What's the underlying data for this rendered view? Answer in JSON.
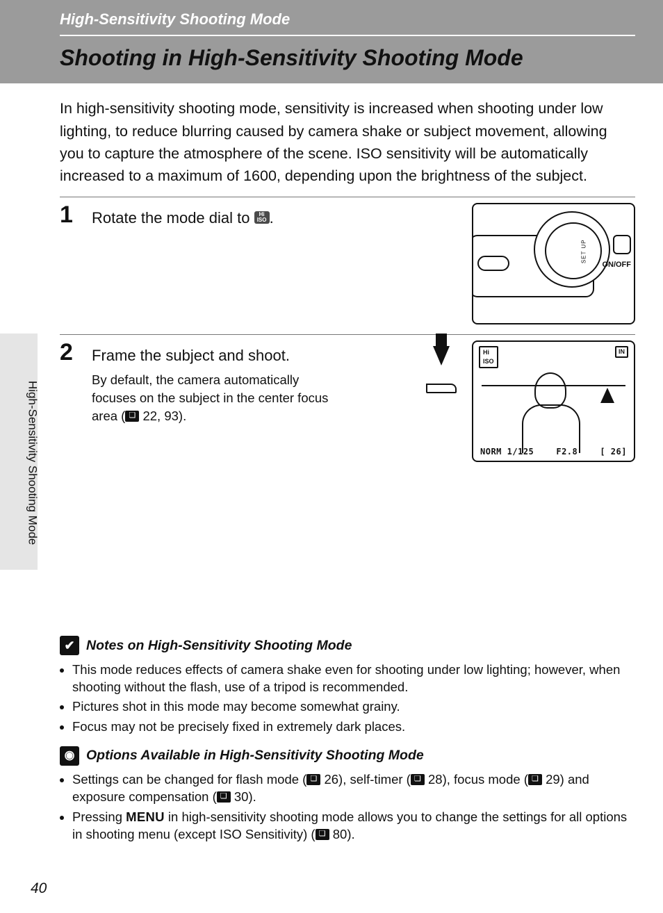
{
  "section_title": "High-Sensitivity Shooting Mode",
  "page_title": "Shooting in High-Sensitivity Shooting Mode",
  "intro": "In high-sensitivity shooting mode, sensitivity is increased when shooting under low lighting, to reduce blurring caused by camera shake or subject movement, allowing you to capture the atmosphere of the scene. ISO sensitivity will be automatically increased to a maximum of 1600, depending upon the brightness of the subject.",
  "steps": [
    {
      "num": "1",
      "title_pre": "Rotate the mode dial to ",
      "title_post": ".",
      "desc": ""
    },
    {
      "num": "2",
      "title_pre": "Frame the subject and shoot.",
      "title_post": "",
      "desc_pre": "By default, the camera automatically focuses on the subject in the center focus area (",
      "desc_refs": " 22, 93",
      "desc_post": ")."
    }
  ],
  "dial": {
    "setup": "SET UP",
    "onoff": "ON/OFF"
  },
  "lcd": {
    "hi": "Hi",
    "iso": "ISO",
    "in": "IN",
    "norm": "NORM",
    "shutter": "1/125",
    "aperture": "F2.8",
    "remaining": "[   26]"
  },
  "side_label": "High-Sensitivity Shooting Mode",
  "notes1_title": "Notes on High-Sensitivity Shooting Mode",
  "notes1": [
    "This mode reduces effects of camera shake even for shooting under low lighting; however, when shooting without the flash, use of a tripod is recommended.",
    "Pictures shot in this mode may become somewhat grainy.",
    "Focus may not be precisely fixed in extremely dark places."
  ],
  "notes2_title": "Options Available in High-Sensitivity Shooting Mode",
  "notes2": {
    "a_pre": "Settings can be changed for flash mode (",
    "a_r1": " 26), self-timer (",
    "a_r2": " 28), focus mode (",
    "a_r3": " 29) and exposure compensation (",
    "a_r4": " 30).",
    "b_pre": "Pressing ",
    "b_menu": "MENU",
    "b_mid": " in high-sensitivity shooting mode allows you to change the settings for all options in shooting menu (except ISO Sensitivity) (",
    "b_ref": " 80)."
  },
  "page_number": "40",
  "icons": {
    "check": "✔",
    "tip": "◉"
  }
}
